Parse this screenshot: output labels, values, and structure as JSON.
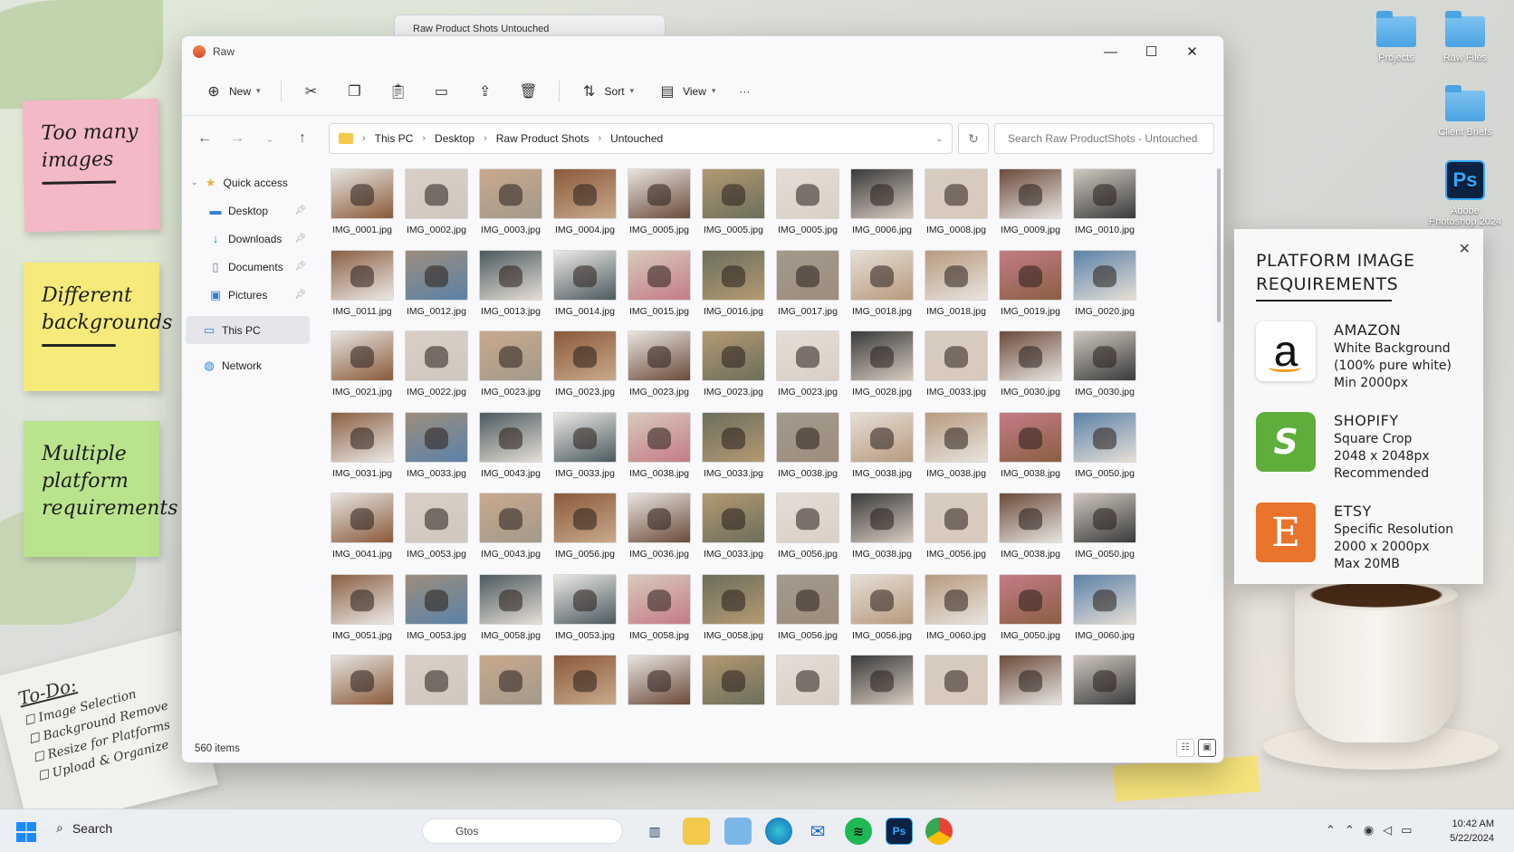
{
  "background_window": {
    "title": "Raw Product Shots Untouched"
  },
  "desktop": {
    "icons": [
      {
        "label": "Projects",
        "icon": "folder-icon"
      },
      {
        "label": "Raw Files",
        "icon": "folder-icon"
      },
      {
        "label": "Client Briefs",
        "icon": "folder-icon"
      },
      {
        "label": "Adobe Photoshop 2024",
        "icon": "photoshop-icon"
      }
    ],
    "sticky_notes": [
      {
        "text": "Too many images",
        "color": "#f4b9c6"
      },
      {
        "text": "Different backgrounds",
        "color": "#f6eb7a"
      },
      {
        "text": "Multiple platform requirements",
        "color": "#b9e48d"
      }
    ],
    "todo": {
      "title": "To-Do:",
      "items": [
        "Image Selection",
        "Background Remove",
        "Resize for Platforms",
        "Upload & Organize"
      ]
    }
  },
  "explorer": {
    "title": "Raw",
    "toolbar": {
      "new": "New",
      "sort": "Sort",
      "view": "View",
      "more": "···"
    },
    "breadcrumb": [
      "This PC",
      "Desktop",
      "Raw Product Shots",
      "Untouched"
    ],
    "search_placeholder": "Search Raw ProductShots - Untouched",
    "sidebar": {
      "quick_access": "Quick access",
      "items": [
        "Desktop",
        "Downloads",
        "Documents",
        "Pictures"
      ],
      "this_pc": "This PC",
      "network": "Network"
    },
    "status": "560 items",
    "files": [
      "IMG_0001.jpg",
      "IMG_0002.jpg",
      "IMG_0003.jpg",
      "IMG_0004.jpg",
      "IMG_0005.jpg",
      "IMG_0005.jpg",
      "IMG_0005.jpg",
      "IMG_0006.jpg",
      "IMG_0008.jpg",
      "IMG_0009.jpg",
      "IMG_0010.jpg",
      "IMG_0011.jpg",
      "IMG_0012.jpg",
      "IMG_0013.jpg",
      "IMG_0014.jpg",
      "IMG_0015.jpg",
      "IMG_0016.jpg",
      "IMG_0017.jpg",
      "IMG_0018.jpg",
      "IMG_0018.jpg",
      "IMG_0019.jpg",
      "IMG_0020.jpg",
      "IMG_0021.jpg",
      "IMG_0022.jpg",
      "IMG_0023.jpg",
      "IMG_0023.jpg",
      "IMG_0023.jpg",
      "IMG_0023.jpg",
      "IMG_0023.jpg",
      "IMG_0028.jpg",
      "IMG_0033.jpg",
      "IMG_0030.jpg",
      "IMG_0030.jpg",
      "IMG_0031.jpg",
      "IMG_0033.jpg",
      "IMG_0043.jpg",
      "IMG_0033.jpg",
      "IMG_0038.jpg",
      "IMG_0033.jpg",
      "IMG_0038.jpg",
      "IMG_0038.jpg",
      "IMG_0038.jpg",
      "IMG_0038.jpg",
      "IMG_0050.jpg",
      "IMG_0041.jpg",
      "IMG_0053.jpg",
      "IMG_0043.jpg",
      "IMG_0056.jpg",
      "IMG_0036.jpg",
      "IMG_0033.jpg",
      "IMG_0056.jpg",
      "IMG_0038.jpg",
      "IMG_0056.jpg",
      "IMG_0038.jpg",
      "IMG_0050.jpg",
      "IMG_0051.jpg",
      "IMG_0053.jpg",
      "IMG_0058.jpg",
      "IMG_0053.jpg",
      "IMG_0058.jpg",
      "IMG_0058.jpg",
      "IMG_0056.jpg",
      "IMG_0056.jpg",
      "IMG_0060.jpg",
      "IMG_0050.jpg",
      "IMG_0060.jpg",
      "",
      "",
      "",
      "",
      "",
      "",
      "",
      "",
      "",
      "",
      ""
    ],
    "thumb_colors": [
      "#e7e5e1",
      "#d9cfc6",
      "#c9a98c",
      "#8a5a3a",
      "#e8e4df",
      "#b39a72",
      "#e5ded6",
      "#3a3a3a",
      "#d7ccc1",
      "#6b4a3a",
      "#cfc8bf",
      "#8a5f43",
      "#9d8d7c",
      "#4c5a5f",
      "#ece9e6",
      "#d8c9bc",
      "#6c6e5c",
      "#a29a8c",
      "#e6dfd6",
      "#b79a7e",
      "#c47c86",
      "#5b82a8"
    ]
  },
  "requirements": {
    "title": "PLATFORM IMAGE REQUIREMENTS",
    "platforms": [
      {
        "name": "AMAZON",
        "lines": [
          "White Background",
          "(100% pure white)",
          "Min 2000px"
        ],
        "logo": "a"
      },
      {
        "name": "SHOPIFY",
        "lines": [
          "Square Crop",
          "2048 x 2048px",
          "Recommended"
        ],
        "logo": "S"
      },
      {
        "name": "ETSY",
        "lines": [
          "Specific Resolution",
          "2000 x 2000px",
          "Max 20MB"
        ],
        "logo": "E"
      }
    ]
  },
  "taskbar": {
    "search_label": "Search",
    "widget_text": "Gtos",
    "time": "10:42 AM",
    "date": "5/22/2024"
  }
}
